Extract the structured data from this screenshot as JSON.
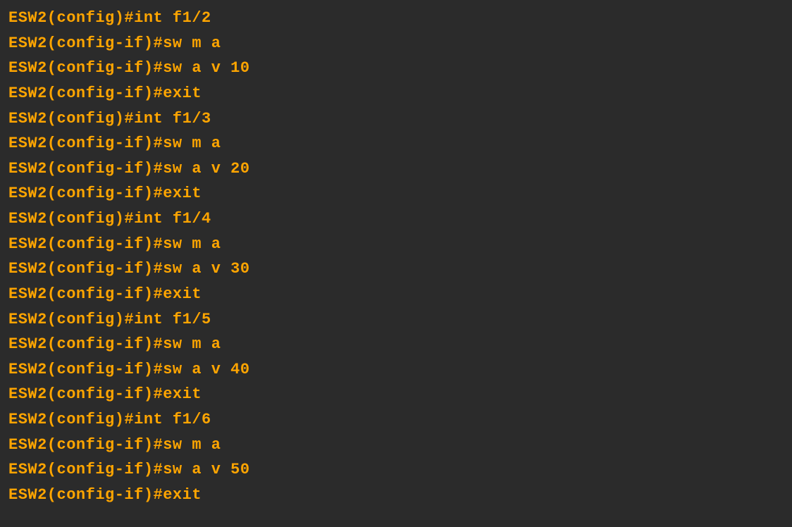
{
  "terminal": {
    "lines": [
      "ESW2(config)#int f1/2",
      "ESW2(config-if)#sw m a",
      "ESW2(config-if)#sw a v 10",
      "ESW2(config-if)#exit",
      "ESW2(config)#int f1/3",
      "ESW2(config-if)#sw m a",
      "ESW2(config-if)#sw a v 20",
      "ESW2(config-if)#exit",
      "ESW2(config)#int f1/4",
      "ESW2(config-if)#sw m a",
      "ESW2(config-if)#sw a v 30",
      "ESW2(config-if)#exit",
      "ESW2(config)#int f1/5",
      "ESW2(config-if)#sw m a",
      "ESW2(config-if)#sw a v 40",
      "ESW2(config-if)#exit",
      "ESW2(config)#int f1/6",
      "ESW2(config-if)#sw m a",
      "ESW2(config-if)#sw a v 50",
      "ESW2(config-if)#exit"
    ]
  }
}
